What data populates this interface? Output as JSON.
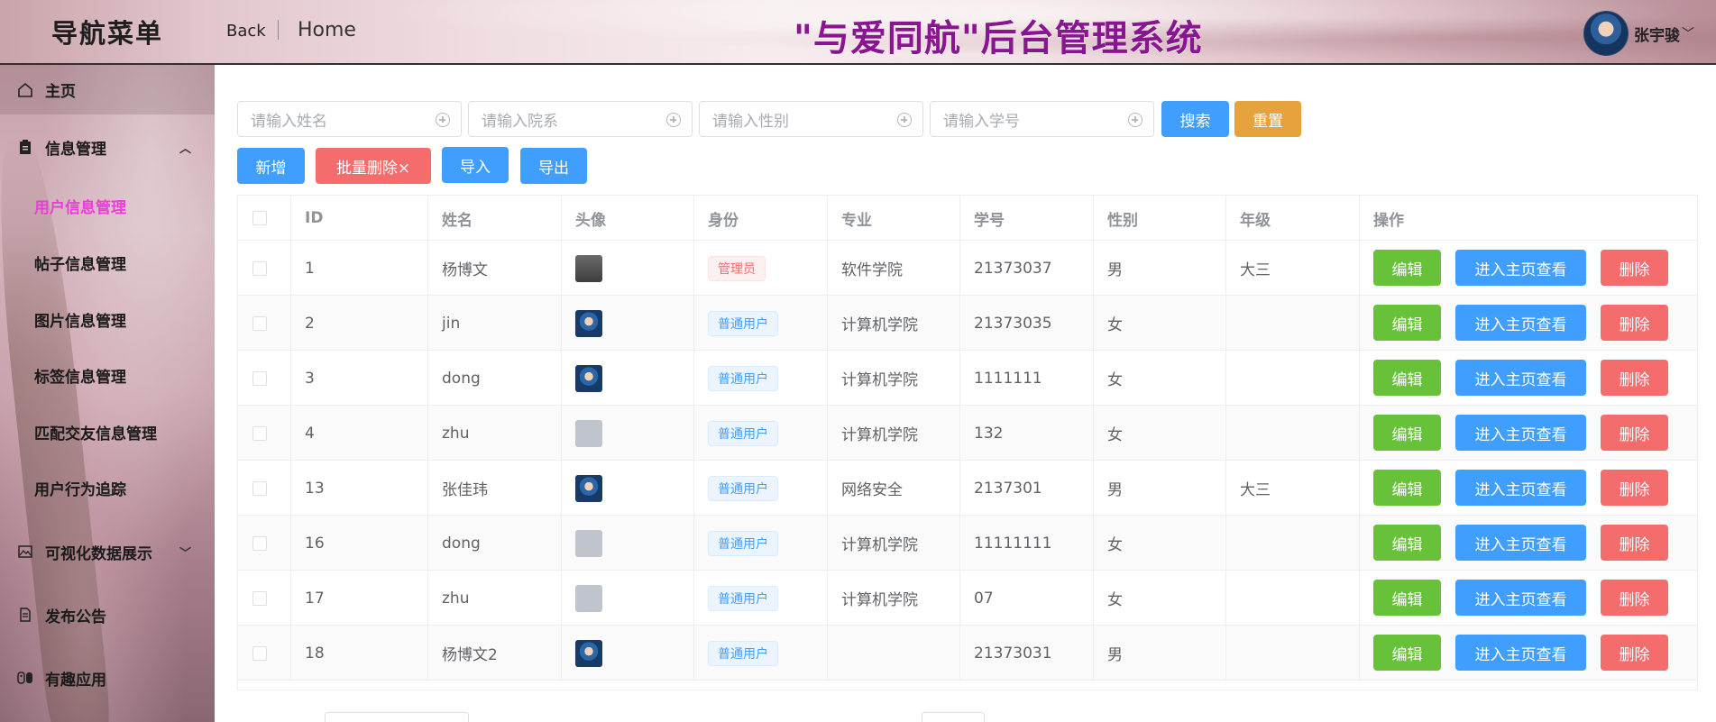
{
  "header": {
    "menu_title": "导航菜单",
    "back": "Back",
    "breadcrumb_home": "Home",
    "system_title": "\"与爱同航\"后台管理系统",
    "user_name": "张宇骏",
    "user_caret": "﹀"
  },
  "sidebar": {
    "home": "主页",
    "info_mgmt": "信息管理",
    "info_caret": "︿",
    "sub_items": [
      "用户信息管理",
      "帖子信息管理",
      "图片信息管理",
      "标签信息管理",
      "匹配交友信息管理",
      "用户行为追踪"
    ],
    "visual": "可视化数据展示",
    "visual_caret": "﹀",
    "notice": "发布公告",
    "fun": "有趣应用"
  },
  "search": {
    "name_placeholder": "请输入姓名",
    "dept_placeholder": "请输入院系",
    "gender_placeholder": "请输入性别",
    "id_placeholder": "请输入学号",
    "search_btn": "搜索",
    "reset_btn": "重置"
  },
  "toolbar": {
    "add": "新增",
    "batch_delete": "批量删除×",
    "import": "导入",
    "export": "导出"
  },
  "table": {
    "columns": [
      "ID",
      "姓名",
      "头像",
      "身份",
      "专业",
      "学号",
      "性别",
      "年级",
      "操作"
    ],
    "actions": {
      "edit": "编辑",
      "view": "进入主页查看",
      "delete": "删除"
    },
    "rows": [
      {
        "id": "1",
        "name": "杨博文",
        "avatar": "dark",
        "role": "管理员",
        "major": "软件学院",
        "sid": "21373037",
        "gender": "男",
        "grade": "大三"
      },
      {
        "id": "2",
        "name": "jin",
        "avatar": "anime",
        "role": "普通用户",
        "major": "计算机学院",
        "sid": "21373035",
        "gender": "女",
        "grade": ""
      },
      {
        "id": "3",
        "name": "dong",
        "avatar": "anime",
        "role": "普通用户",
        "major": "计算机学院",
        "sid": "1111111",
        "gender": "女",
        "grade": ""
      },
      {
        "id": "4",
        "name": "zhu",
        "avatar": "gray",
        "role": "普通用户",
        "major": "计算机学院",
        "sid": "132",
        "gender": "女",
        "grade": ""
      },
      {
        "id": "13",
        "name": "张佳玮",
        "avatar": "anime",
        "role": "普通用户",
        "major": "网络安全",
        "sid": "2137301",
        "gender": "男",
        "grade": "大三"
      },
      {
        "id": "16",
        "name": "dong",
        "avatar": "gray",
        "role": "普通用户",
        "major": "计算机学院",
        "sid": "11111111",
        "gender": "女",
        "grade": ""
      },
      {
        "id": "17",
        "name": "zhu",
        "avatar": "gray",
        "role": "普通用户",
        "major": "计算机学院",
        "sid": "07",
        "gender": "女",
        "grade": ""
      },
      {
        "id": "18",
        "name": "杨博文2",
        "avatar": "anime",
        "role": "普通用户",
        "major": "",
        "sid": "21373031",
        "gender": "男",
        "grade": ""
      }
    ]
  },
  "colors": {
    "primary": "#409eff",
    "success": "#67c23a",
    "warning": "#e6a23c",
    "danger": "#f56c6c",
    "active_menu": "#e83fd8",
    "title_purple": "#8a1590"
  }
}
